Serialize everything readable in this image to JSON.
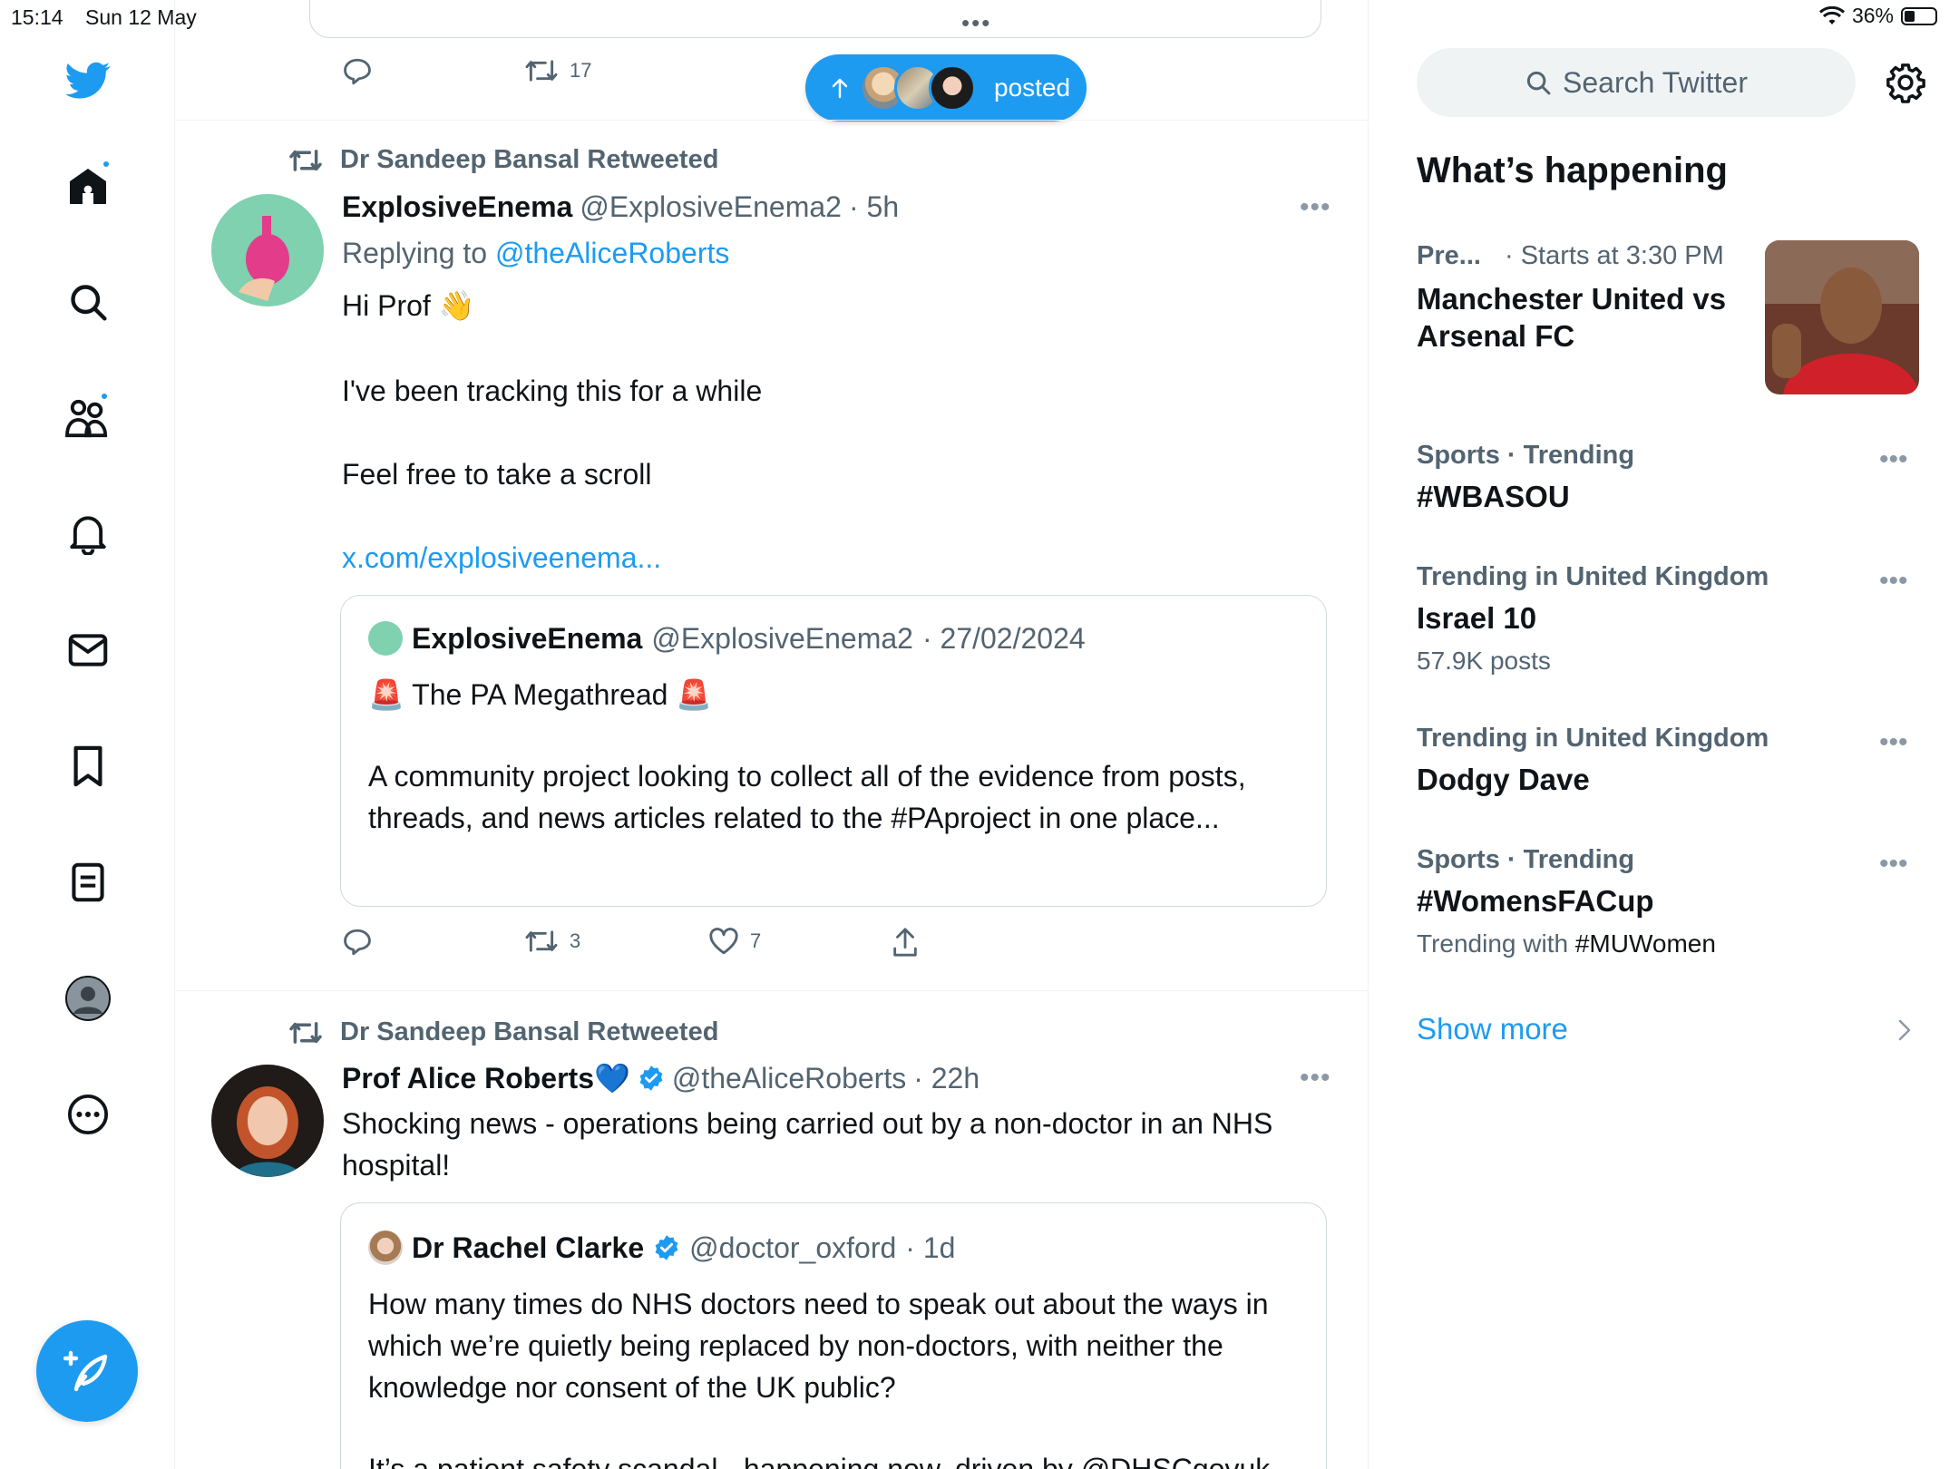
{
  "status_bar": {
    "time": "15:14",
    "date": "Sun 12 May",
    "battery": "36%"
  },
  "nav": {
    "items": [
      "home",
      "explore",
      "communities",
      "notifications",
      "messages",
      "bookmarks",
      "lists",
      "profile",
      "more"
    ]
  },
  "top_tweet": {
    "retweets": "17"
  },
  "new_posts_pill": {
    "label": "posted"
  },
  "tweet1": {
    "retweeted_by": "Dr Sandeep Bansal Retweeted",
    "name": "ExplosiveEnema",
    "handle": "@ExplosiveEnema2",
    "time": "· 5h",
    "replying_prefix": "Replying to",
    "replying_to": "@theAliceRoberts",
    "line1": "Hi Prof 👋",
    "line2": "I've been tracking this for a while",
    "line3": "Feel free to take a scroll",
    "link": "x.com/explosiveenema...",
    "quote": {
      "name": "ExplosiveEnema",
      "handle": "@ExplosiveEnema2",
      "date": "· 27/02/2024",
      "title": "🚨 The PA Megathread 🚨",
      "text": "A community project looking to collect all of the evidence from posts, threads, and news articles related to the #PAproject in one place..."
    },
    "retweets": "3",
    "likes": "7"
  },
  "tweet2": {
    "retweeted_by": "Dr Sandeep Bansal Retweeted",
    "name": "Prof Alice Roberts💙",
    "handle": "@theAliceRoberts",
    "time": "· 22h",
    "text": "Shocking news - operations being carried out by a non-doctor in an NHS hospital!",
    "quote": {
      "name": "Dr Rachel Clarke",
      "handle": "@doctor_oxford",
      "time": "· 1d",
      "text": "How many times do NHS doctors need to speak out about the ways in which we’re quietly being replaced by non-doctors, with neither the knowledge nor consent of the UK public?",
      "text2": "It’s a patient safety scandal - happening now, driven by @DHSCgovuk"
    }
  },
  "sidebar": {
    "search_placeholder": "Search Twitter",
    "title": "What’s happening",
    "event": {
      "category": "Pre...",
      "meta": "· Starts at 3:30 PM",
      "title": "Manchester United vs Arsenal FC"
    },
    "trends": [
      {
        "meta": "Sports · Trending",
        "name": "#WBASOU",
        "sub": ""
      },
      {
        "meta": "Trending in United Kingdom",
        "name": "Israel 10",
        "sub": "57.9K posts"
      },
      {
        "meta": "Trending in United Kingdom",
        "name": "Dodgy Dave",
        "sub": ""
      },
      {
        "meta": "Sports · Trending",
        "name": "#WomensFACup",
        "sub_prefix": "Trending with",
        "sub_tag": "#MUWomen"
      }
    ],
    "show_more": "Show more"
  },
  "colors": {
    "accent": "#1d9bf0",
    "text": "#0f1419",
    "muted": "#536471",
    "border": "#cfd9de"
  }
}
